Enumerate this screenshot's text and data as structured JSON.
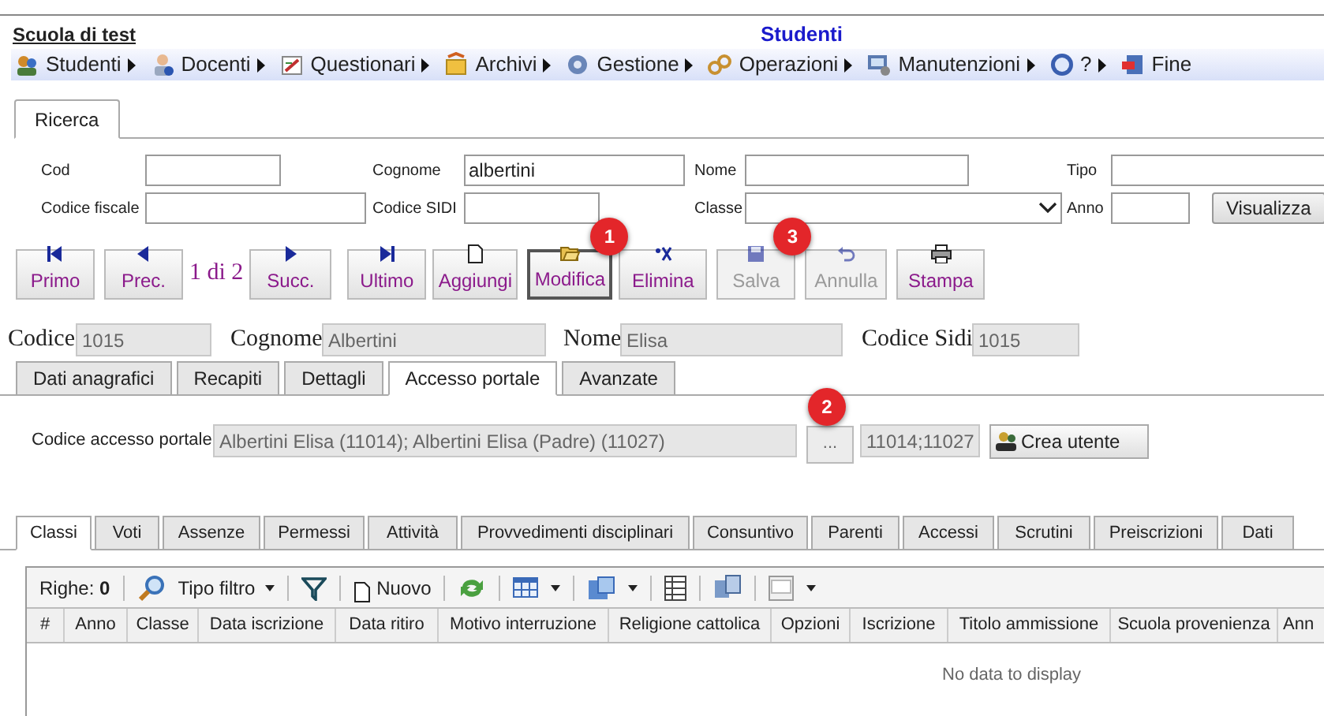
{
  "header": {
    "school": "Scuola di test",
    "page_title": "Studenti"
  },
  "menu": [
    {
      "label": "Studenti",
      "submenu": true
    },
    {
      "label": "Docenti",
      "submenu": true
    },
    {
      "label": "Questionari",
      "submenu": true
    },
    {
      "label": "Archivi",
      "submenu": true
    },
    {
      "label": "Gestione",
      "submenu": true
    },
    {
      "label": "Operazioni",
      "submenu": true
    },
    {
      "label": "Manutenzioni",
      "submenu": true
    },
    {
      "label": "?",
      "submenu": true
    },
    {
      "label": "Fine",
      "submenu": false
    }
  ],
  "search_tabs": [
    {
      "label": "Ricerca",
      "selected": true
    }
  ],
  "search_rows": [
    [
      {
        "label": "Cod",
        "kind": "text"
      },
      {
        "label": "Cognome",
        "kind": "text",
        "value": "albertini"
      },
      {
        "label": "Nome",
        "kind": "text"
      },
      {
        "label": "Tipo",
        "kind": "text"
      }
    ],
    [
      {
        "label": "Codice fiscale",
        "kind": "text"
      },
      {
        "label": "Codice SIDI",
        "kind": "text"
      },
      {
        "label": "Classe",
        "kind": "select"
      },
      {
        "label": "Anno",
        "kind": "text"
      }
    ]
  ],
  "search_button": "Visualizza",
  "record_toolbar": [
    {
      "kind": "button",
      "label": "Primo",
      "disabled": false,
      "highlighted": false
    },
    {
      "kind": "button",
      "label": "Prec.",
      "disabled": false,
      "highlighted": false
    },
    {
      "kind": "pager",
      "label": "1 di 2"
    },
    {
      "kind": "button",
      "label": "Succ.",
      "disabled": false,
      "highlighted": false
    },
    {
      "kind": "button",
      "label": "Ultimo",
      "disabled": false,
      "highlighted": false
    },
    {
      "kind": "button",
      "label": "Aggiungi",
      "disabled": false,
      "highlighted": false
    },
    {
      "kind": "button",
      "label": "Modifica",
      "disabled": false,
      "highlighted": true,
      "badge": "1"
    },
    {
      "kind": "button",
      "label": "Elimina",
      "disabled": false,
      "highlighted": false
    },
    {
      "kind": "button",
      "label": "Salva",
      "disabled": true,
      "highlighted": false,
      "badge": "3"
    },
    {
      "kind": "button",
      "label": "Annulla",
      "disabled": true,
      "highlighted": false
    },
    {
      "kind": "button",
      "label": "Stampa",
      "disabled": false,
      "highlighted": false
    }
  ],
  "record": [
    {
      "label": "Codice",
      "value": "1015"
    },
    {
      "label": "Cognome",
      "value": "Albertini"
    },
    {
      "label": "Nome",
      "value": "Elisa"
    },
    {
      "label": "Codice Sidi",
      "value": "1015"
    }
  ],
  "detail_tabs": [
    {
      "label": "Dati anagrafici",
      "selected": false
    },
    {
      "label": "Recapiti",
      "selected": false
    },
    {
      "label": "Dettagli",
      "selected": false
    },
    {
      "label": "Accesso portale",
      "selected": true
    },
    {
      "label": "Avanzate",
      "selected": false
    }
  ],
  "portal": {
    "label": "Codice accesso portale",
    "value": "Albertini Elisa (11014); Albertini Elisa (Padre) (11027)",
    "browse_button": {
      "label": "...",
      "badge": "2"
    },
    "codes": "11014;11027",
    "create_button": "Crea utente"
  },
  "bottom_tabs": [
    {
      "label": "Classi",
      "selected": true
    },
    {
      "label": "Voti",
      "selected": false
    },
    {
      "label": "Assenze",
      "selected": false
    },
    {
      "label": "Permessi",
      "selected": false
    },
    {
      "label": "Attività",
      "selected": false
    },
    {
      "label": "Provvedimenti disciplinari",
      "selected": false
    },
    {
      "label": "Consuntivo",
      "selected": false
    },
    {
      "label": "Parenti",
      "selected": false
    },
    {
      "label": "Accessi",
      "selected": false
    },
    {
      "label": "Scrutini",
      "selected": false
    },
    {
      "label": "Preiscrizioni",
      "selected": false
    },
    {
      "label": "Dati",
      "selected": false
    }
  ],
  "grid": {
    "rows_label": "Righe:",
    "rows_count": "0",
    "filter_type": "Tipo filtro",
    "new_button": "Nuovo",
    "columns": [
      "#",
      "Anno",
      "Classe",
      "Data iscrizione",
      "Data ritiro",
      "Motivo interruzione",
      "Religione cattolica",
      "Opzioni",
      "Iscrizione",
      "Titolo ammissione",
      "Scuola provenienza",
      "Ann"
    ],
    "empty_text": "No data to display"
  }
}
